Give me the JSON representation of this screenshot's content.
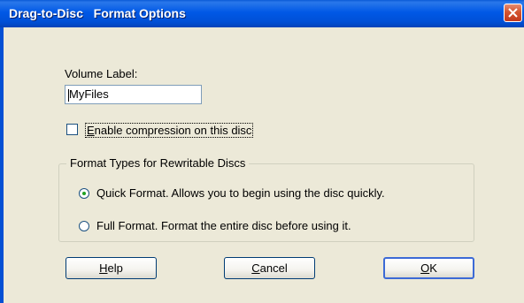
{
  "window": {
    "title": "Drag-to-Disc   Format Options"
  },
  "volume": {
    "label": "Volume Label:",
    "value": "MyFiles"
  },
  "compression": {
    "label_first": "E",
    "label_rest": "nable compression on this disc",
    "checked": false
  },
  "format_group": {
    "legend": "Format Types for Rewritable Discs",
    "options": [
      {
        "label": "Quick Format.  Allows you to begin using the disc quickly.",
        "selected": true
      },
      {
        "label": "Full Format.  Format the entire disc before using it.",
        "selected": false
      }
    ]
  },
  "buttons": {
    "help_first": "H",
    "help_rest": "elp",
    "cancel_first": "C",
    "cancel_rest": "ancel",
    "ok_first": "O",
    "ok_rest": "K"
  },
  "colors": {
    "title_bar": "#0058e6",
    "dialog_bg": "#ece9d8",
    "close_button": "#d4542f",
    "radio_dot": "#21a121"
  }
}
